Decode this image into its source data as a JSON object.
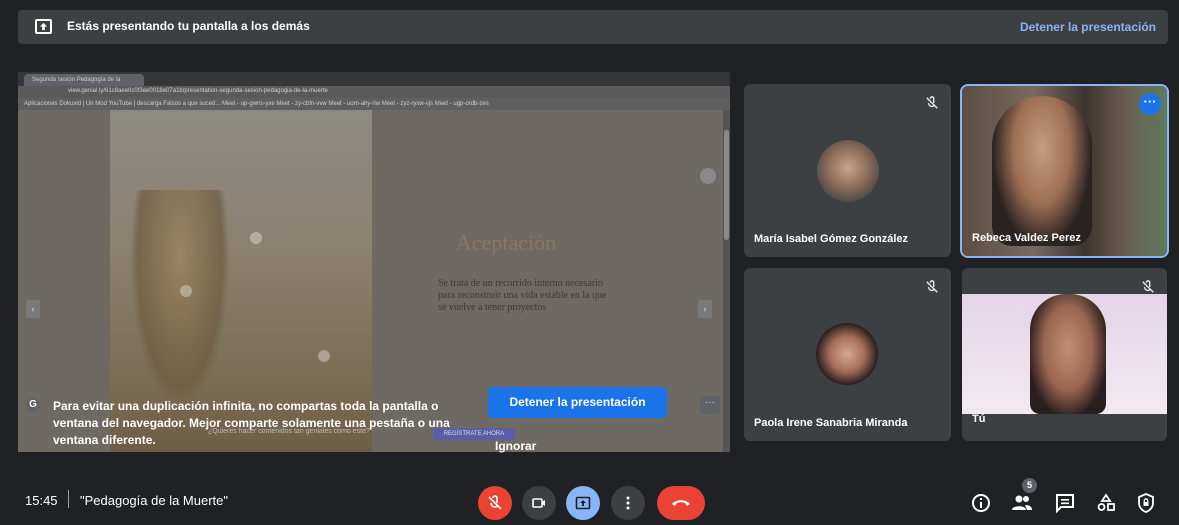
{
  "banner": {
    "message": "Estás presentando tu pantalla a los demás",
    "stop_link": "Detener la presentación"
  },
  "shared_screen": {
    "browser_tab": "Segunda sesión Pedagogía de la",
    "url": "view.genial.ly/61c8aee0c0f3ee0018e07a1b/presentation-segunda-sesion-pedagogia-de-la-muerte",
    "bookmarks": "Aplicaciones   Dokuvid | Un Mod   YouTube | descarga   Falsos a que suced...   Meet - up-gwns-yxe   Meet - zy-cbfn-vvw   Meet - uom-ahy-riw   Meet - zyz-ryxw-vjs   Meet - ugp-ordb-zes",
    "slide_title": "Aceptación",
    "slide_body": "Se trata de un recorrido interno necesario para reconstruir una vida estable en la que se vuelve a tener proyectos",
    "footer_text": "¿Quieres hacer contenidos tan geniales como este?",
    "footer_button": "REGÍSTRATE AHORA"
  },
  "warning": {
    "text": "Para evitar una duplicación infinita, no compartas toda la pantalla o ventana del navegador. Mejor comparte solamente una pestaña o una ventana diferente.",
    "stop_button": "Detener la presentación",
    "ignore": "Ignorar"
  },
  "participants": [
    {
      "name": "María Isabel Gómez González"
    },
    {
      "name": "Rebeca Valdez Perez"
    },
    {
      "name": "Paola Irene Sanabria Miranda"
    },
    {
      "name": "Tú"
    }
  ],
  "bottom": {
    "time": "15:45",
    "meeting_name": "\"Pedagogía de la Muerte\"",
    "people_count": "5"
  },
  "colors": {
    "background": "#202124",
    "tile": "#3c4043",
    "accent": "#8ab4f8",
    "danger": "#ea4335",
    "primary": "#1a73e8"
  }
}
